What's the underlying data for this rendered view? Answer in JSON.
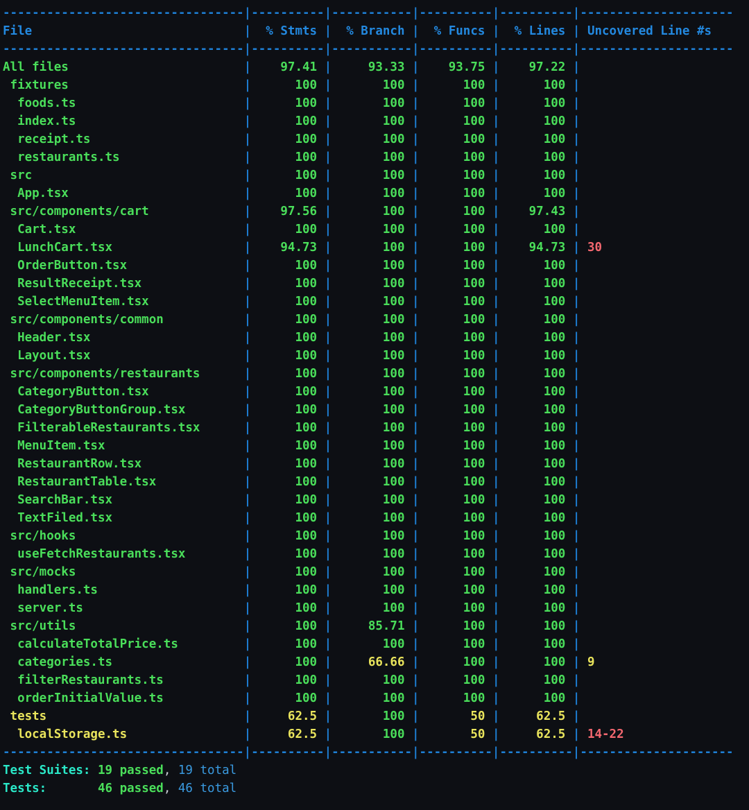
{
  "terminal": {
    "title": "jest coverage report",
    "colors": {
      "background": "#0d0f14",
      "separator": "#1e7fd4",
      "header": "#2389e0",
      "high_coverage": "#4ade5a",
      "medium_coverage": "#e9e45c",
      "uncovered": "#f2676f",
      "label": "#2ae8c8",
      "total": "#3a9ae0"
    },
    "columns": [
      {
        "key": "file",
        "label": "File",
        "width": 32,
        "align": "left"
      },
      {
        "key": "stmts",
        "label": "% Stmts",
        "width": 8,
        "align": "right"
      },
      {
        "key": "branch",
        "label": "% Branch",
        "width": 9,
        "align": "right"
      },
      {
        "key": "funcs",
        "label": "% Funcs",
        "width": 8,
        "align": "right"
      },
      {
        "key": "lines",
        "label": "% Lines",
        "width": 8,
        "align": "right"
      },
      {
        "key": "uncovered",
        "label": "Uncovered Line #s",
        "width": 19,
        "align": "left"
      }
    ],
    "rows": [
      {
        "file": "All files",
        "indent": 0,
        "stmts": "97.41",
        "branch": "93.33",
        "funcs": "93.75",
        "lines": "97.22",
        "uncovered": "",
        "level": "high"
      },
      {
        "file": "fixtures",
        "indent": 1,
        "stmts": "100",
        "branch": "100",
        "funcs": "100",
        "lines": "100",
        "uncovered": "",
        "level": "high"
      },
      {
        "file": "foods.ts",
        "indent": 2,
        "stmts": "100",
        "branch": "100",
        "funcs": "100",
        "lines": "100",
        "uncovered": "",
        "level": "high"
      },
      {
        "file": "index.ts",
        "indent": 2,
        "stmts": "100",
        "branch": "100",
        "funcs": "100",
        "lines": "100",
        "uncovered": "",
        "level": "high"
      },
      {
        "file": "receipt.ts",
        "indent": 2,
        "stmts": "100",
        "branch": "100",
        "funcs": "100",
        "lines": "100",
        "uncovered": "",
        "level": "high"
      },
      {
        "file": "restaurants.ts",
        "indent": 2,
        "stmts": "100",
        "branch": "100",
        "funcs": "100",
        "lines": "100",
        "uncovered": "",
        "level": "high"
      },
      {
        "file": "src",
        "indent": 1,
        "stmts": "100",
        "branch": "100",
        "funcs": "100",
        "lines": "100",
        "uncovered": "",
        "level": "high"
      },
      {
        "file": "App.tsx",
        "indent": 2,
        "stmts": "100",
        "branch": "100",
        "funcs": "100",
        "lines": "100",
        "uncovered": "",
        "level": "high"
      },
      {
        "file": "src/components/cart",
        "indent": 1,
        "stmts": "97.56",
        "branch": "100",
        "funcs": "100",
        "lines": "97.43",
        "uncovered": "",
        "level": "high"
      },
      {
        "file": "Cart.tsx",
        "indent": 2,
        "stmts": "100",
        "branch": "100",
        "funcs": "100",
        "lines": "100",
        "uncovered": "",
        "level": "high"
      },
      {
        "file": "LunchCart.tsx",
        "indent": 2,
        "stmts": "94.73",
        "branch": "100",
        "funcs": "100",
        "lines": "94.73",
        "uncovered": "30",
        "level": "high"
      },
      {
        "file": "OrderButton.tsx",
        "indent": 2,
        "stmts": "100",
        "branch": "100",
        "funcs": "100",
        "lines": "100",
        "uncovered": "",
        "level": "high"
      },
      {
        "file": "ResultReceipt.tsx",
        "indent": 2,
        "stmts": "100",
        "branch": "100",
        "funcs": "100",
        "lines": "100",
        "uncovered": "",
        "level": "high"
      },
      {
        "file": "SelectMenuItem.tsx",
        "indent": 2,
        "stmts": "100",
        "branch": "100",
        "funcs": "100",
        "lines": "100",
        "uncovered": "",
        "level": "high"
      },
      {
        "file": "src/components/common",
        "indent": 1,
        "stmts": "100",
        "branch": "100",
        "funcs": "100",
        "lines": "100",
        "uncovered": "",
        "level": "high"
      },
      {
        "file": "Header.tsx",
        "indent": 2,
        "stmts": "100",
        "branch": "100",
        "funcs": "100",
        "lines": "100",
        "uncovered": "",
        "level": "high"
      },
      {
        "file": "Layout.tsx",
        "indent": 2,
        "stmts": "100",
        "branch": "100",
        "funcs": "100",
        "lines": "100",
        "uncovered": "",
        "level": "high"
      },
      {
        "file": "src/components/restaurants",
        "indent": 1,
        "stmts": "100",
        "branch": "100",
        "funcs": "100",
        "lines": "100",
        "uncovered": "",
        "level": "high"
      },
      {
        "file": "CategoryButton.tsx",
        "indent": 2,
        "stmts": "100",
        "branch": "100",
        "funcs": "100",
        "lines": "100",
        "uncovered": "",
        "level": "high"
      },
      {
        "file": "CategoryButtonGroup.tsx",
        "indent": 2,
        "stmts": "100",
        "branch": "100",
        "funcs": "100",
        "lines": "100",
        "uncovered": "",
        "level": "high"
      },
      {
        "file": "FilterableRestaurants.tsx",
        "indent": 2,
        "stmts": "100",
        "branch": "100",
        "funcs": "100",
        "lines": "100",
        "uncovered": "",
        "level": "high"
      },
      {
        "file": "MenuItem.tsx",
        "indent": 2,
        "stmts": "100",
        "branch": "100",
        "funcs": "100",
        "lines": "100",
        "uncovered": "",
        "level": "high"
      },
      {
        "file": "RestaurantRow.tsx",
        "indent": 2,
        "stmts": "100",
        "branch": "100",
        "funcs": "100",
        "lines": "100",
        "uncovered": "",
        "level": "high"
      },
      {
        "file": "RestaurantTable.tsx",
        "indent": 2,
        "stmts": "100",
        "branch": "100",
        "funcs": "100",
        "lines": "100",
        "uncovered": "",
        "level": "high"
      },
      {
        "file": "SearchBar.tsx",
        "indent": 2,
        "stmts": "100",
        "branch": "100",
        "funcs": "100",
        "lines": "100",
        "uncovered": "",
        "level": "high"
      },
      {
        "file": "TextFiled.tsx",
        "indent": 2,
        "stmts": "100",
        "branch": "100",
        "funcs": "100",
        "lines": "100",
        "uncovered": "",
        "level": "high"
      },
      {
        "file": "src/hooks",
        "indent": 1,
        "stmts": "100",
        "branch": "100",
        "funcs": "100",
        "lines": "100",
        "uncovered": "",
        "level": "high"
      },
      {
        "file": "useFetchRestaurants.tsx",
        "indent": 2,
        "stmts": "100",
        "branch": "100",
        "funcs": "100",
        "lines": "100",
        "uncovered": "",
        "level": "high"
      },
      {
        "file": "src/mocks",
        "indent": 1,
        "stmts": "100",
        "branch": "100",
        "funcs": "100",
        "lines": "100",
        "uncovered": "",
        "level": "high"
      },
      {
        "file": "handlers.ts",
        "indent": 2,
        "stmts": "100",
        "branch": "100",
        "funcs": "100",
        "lines": "100",
        "uncovered": "",
        "level": "high"
      },
      {
        "file": "server.ts",
        "indent": 2,
        "stmts": "100",
        "branch": "100",
        "funcs": "100",
        "lines": "100",
        "uncovered": "",
        "level": "high"
      },
      {
        "file": "src/utils",
        "indent": 1,
        "stmts": "100",
        "branch": "85.71",
        "funcs": "100",
        "lines": "100",
        "uncovered": "",
        "level": "high"
      },
      {
        "file": "calculateTotalPrice.ts",
        "indent": 2,
        "stmts": "100",
        "branch": "100",
        "funcs": "100",
        "lines": "100",
        "uncovered": "",
        "level": "high"
      },
      {
        "file": "categories.ts",
        "indent": 2,
        "stmts": "100",
        "branch": "66.66",
        "funcs": "100",
        "lines": "100",
        "uncovered": "9",
        "level": "high",
        "branch_level": "medium",
        "uncovered_level": "medium"
      },
      {
        "file": "filterRestaurants.ts",
        "indent": 2,
        "stmts": "100",
        "branch": "100",
        "funcs": "100",
        "lines": "100",
        "uncovered": "",
        "level": "high"
      },
      {
        "file": "orderInitialValue.ts",
        "indent": 2,
        "stmts": "100",
        "branch": "100",
        "funcs": "100",
        "lines": "100",
        "uncovered": "",
        "level": "high"
      },
      {
        "file": "tests",
        "indent": 1,
        "stmts": "62.5",
        "branch": "100",
        "funcs": "50",
        "lines": "62.5",
        "uncovered": "",
        "level": "medium",
        "branch_level": "high"
      },
      {
        "file": "localStorage.ts",
        "indent": 2,
        "stmts": "62.5",
        "branch": "100",
        "funcs": "50",
        "lines": "62.5",
        "uncovered": "14-22",
        "level": "medium",
        "branch_level": "high",
        "uncovered_level": "low"
      }
    ],
    "summary": [
      {
        "label": "Test Suites:",
        "pad": 1,
        "passed": "19 passed",
        "comma": ",",
        "total": " 19 total"
      },
      {
        "label": "Tests:",
        "pad": 7,
        "passed": "46 passed",
        "comma": ",",
        "total": " 46 total"
      }
    ]
  }
}
